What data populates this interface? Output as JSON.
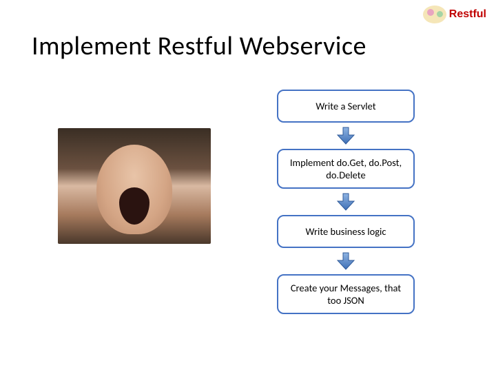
{
  "brand": {
    "label": "Restful"
  },
  "title": "Implement Restful Webservice",
  "image": {
    "alt": "yawning-baby-photo"
  },
  "flow": {
    "steps": [
      {
        "text": "Write a Servlet"
      },
      {
        "text": "Implement do.Get, do.Post, do.Delete"
      },
      {
        "text": "Write business logic"
      },
      {
        "text": "Create your Messages, that too JSON"
      }
    ]
  }
}
